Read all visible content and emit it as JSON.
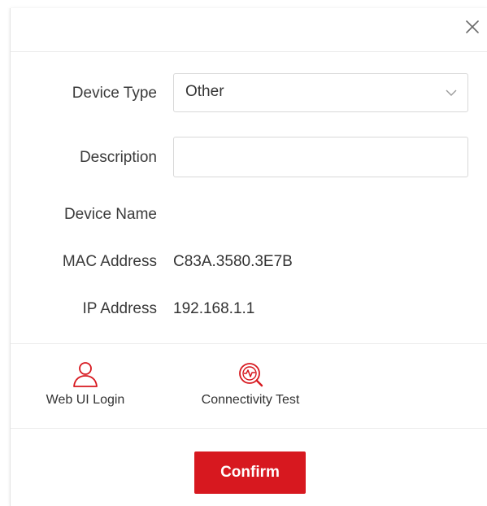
{
  "dialog": {
    "close_icon": "close-icon",
    "accent_color": "#d7181f"
  },
  "form": {
    "device_type_label": "Device Type",
    "device_type_value": "Other",
    "description_label": "Description",
    "description_value": "",
    "device_name_label": "Device Name",
    "device_name_value": "",
    "mac_address_label": "MAC Address",
    "mac_address_value": "C83A.3580.3E7B",
    "ip_address_label": "IP Address",
    "ip_address_value": "192.168.1.1"
  },
  "actions": {
    "web_ui_login_label": "Web UI Login",
    "web_ui_login_icon": "user-icon",
    "connectivity_test_label": "Connectivity Test",
    "connectivity_test_icon": "connectivity-test-icon"
  },
  "footer": {
    "confirm_label": "Confirm"
  }
}
